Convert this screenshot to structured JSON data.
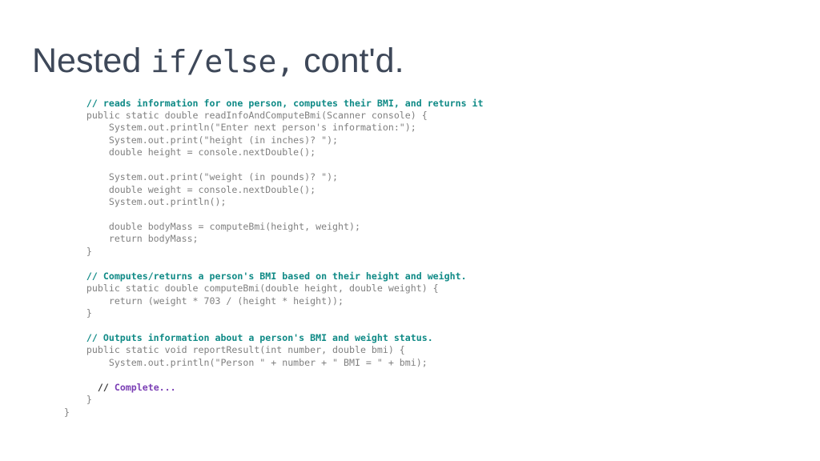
{
  "slide": {
    "title": {
      "prefix": "Nested ",
      "mono": "if/else,",
      "suffix": " cont'd."
    },
    "colors": {
      "title": "#3e4859",
      "code": "#808080",
      "comment": "#0f8a86",
      "slashes": "#333333",
      "todo": "#7b3fb5",
      "background": "#ffffff"
    },
    "code_lines": [
      {
        "indent": 2,
        "kind": "comment",
        "text": "// reads information for one person, computes their BMI, and returns it"
      },
      {
        "indent": 2,
        "kind": "code",
        "text": "public static double readInfoAndComputeBmi(Scanner console) {"
      },
      {
        "indent": 4,
        "kind": "code",
        "text": "System.out.println(\"Enter next person's information:\");"
      },
      {
        "indent": 4,
        "kind": "code",
        "text": "System.out.print(\"height (in inches)? \");"
      },
      {
        "indent": 4,
        "kind": "code",
        "text": "double height = console.nextDouble();"
      },
      {
        "indent": 0,
        "kind": "blank",
        "text": ""
      },
      {
        "indent": 4,
        "kind": "code",
        "text": "System.out.print(\"weight (in pounds)? \");"
      },
      {
        "indent": 4,
        "kind": "code",
        "text": "double weight = console.nextDouble();"
      },
      {
        "indent": 4,
        "kind": "code",
        "text": "System.out.println();"
      },
      {
        "indent": 0,
        "kind": "blank",
        "text": ""
      },
      {
        "indent": 4,
        "kind": "code",
        "text": "double bodyMass = computeBmi(height, weight);"
      },
      {
        "indent": 4,
        "kind": "code",
        "text": "return bodyMass;"
      },
      {
        "indent": 2,
        "kind": "code",
        "text": "}"
      },
      {
        "indent": 0,
        "kind": "blank",
        "text": ""
      },
      {
        "indent": 2,
        "kind": "comment",
        "text": "// Computes/returns a person's BMI based on their height and weight."
      },
      {
        "indent": 2,
        "kind": "code",
        "text": "public static double computeBmi(double height, double weight) {"
      },
      {
        "indent": 4,
        "kind": "code",
        "text": "return (weight * 703 / (height * height));"
      },
      {
        "indent": 2,
        "kind": "code",
        "text": "}"
      },
      {
        "indent": 0,
        "kind": "blank",
        "text": ""
      },
      {
        "indent": 2,
        "kind": "comment",
        "text": "// Outputs information about a person's BMI and weight status."
      },
      {
        "indent": 2,
        "kind": "code",
        "text": "public static void reportResult(int number, double bmi) {"
      },
      {
        "indent": 4,
        "kind": "code",
        "text": "System.out.println(\"Person \" + number + \" BMI = \" + bmi);"
      },
      {
        "indent": 0,
        "kind": "blank",
        "text": ""
      },
      {
        "indent": 3,
        "kind": "todo",
        "slashes": "// ",
        "text": "Complete..."
      },
      {
        "indent": 2,
        "kind": "code",
        "text": "}"
      },
      {
        "indent": 0,
        "kind": "code",
        "text": "}"
      }
    ]
  }
}
